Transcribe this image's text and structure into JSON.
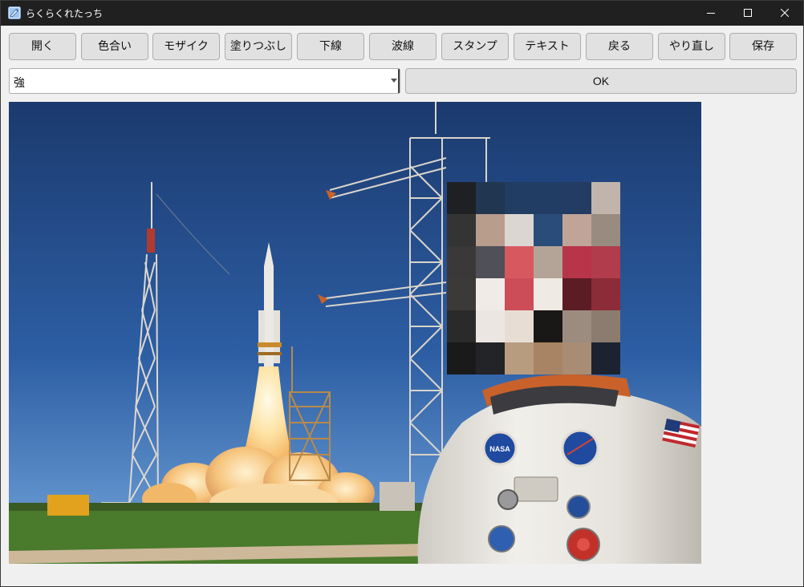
{
  "window": {
    "title": "らくらくれたっち"
  },
  "toolbar": {
    "buttons": [
      {
        "label": "開く"
      },
      {
        "label": "色合い"
      },
      {
        "label": "モザイク"
      },
      {
        "label": "塗りつぶし"
      },
      {
        "label": "下線"
      },
      {
        "label": "波線"
      },
      {
        "label": "スタンプ"
      },
      {
        "label": "テキスト"
      },
      {
        "label": "戻る"
      },
      {
        "label": "やり直し"
      },
      {
        "label": "保存"
      }
    ]
  },
  "strength_select": {
    "value": "強"
  },
  "ok_button": {
    "label": "OK"
  },
  "image": {
    "badge_text": "NASA",
    "colors": {
      "sky_top": "#1b3a6e",
      "sky_mid": "#2d5ea4",
      "sky_low": "#5c8ec9",
      "grass": "#4a7a2c",
      "smoke": "#f3c27a",
      "tower": "#d8d2c8",
      "suit": "#e9e7e2",
      "visor_ring": "#c8622a"
    },
    "mosaic_colors": [
      [
        "#1e2024",
        "#213650",
        "#213d63",
        "#223d64",
        "#223c63",
        "#c0b4ac"
      ],
      [
        "#343434",
        "#b89c8c",
        "#dcd6d2",
        "#2a4c78",
        "#c0a498",
        "#988c80"
      ],
      [
        "#3a3838",
        "#505058",
        "#d85860",
        "#b4a498",
        "#b83448",
        "#b03c4c"
      ],
      [
        "#3c3a38",
        "#f0ebe6",
        "#cc4c58",
        "#f0eae4",
        "#5c1c24",
        "#8c2c38"
      ],
      [
        "#2a2a2a",
        "#ece6e2",
        "#e8ddd4",
        "#1a1816",
        "#9c8c80",
        "#8c7c70"
      ],
      [
        "#1a1a1a",
        "#222428",
        "#b89c80",
        "#a88464",
        "#a88c74",
        "#1c2230"
      ]
    ]
  }
}
